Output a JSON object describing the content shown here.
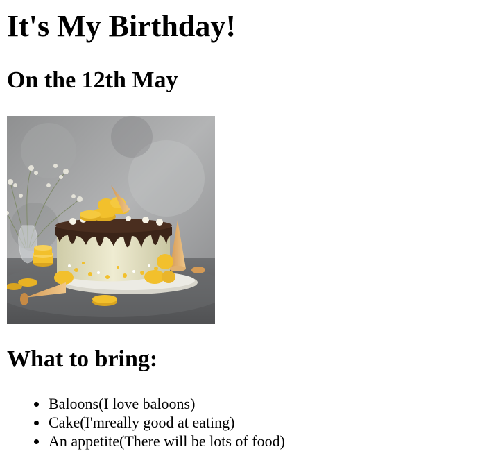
{
  "page": {
    "title": "It's My Birthday!",
    "date_heading": "On the 12th May",
    "bring_heading": "What to bring:",
    "items": [
      "Baloons(I love baloons)",
      "Cake(I'mreally good at eating)",
      "An appetite(There will be lots of food)"
    ]
  },
  "image": {
    "subject": "birthday-cake-photo"
  },
  "colors": {
    "text": "#000000",
    "background": "#ffffff",
    "macaron": "#f2c02c",
    "chocolate": "#3b2418",
    "cream": "#e9e6c8",
    "backdrop": "#9a9b9c"
  }
}
